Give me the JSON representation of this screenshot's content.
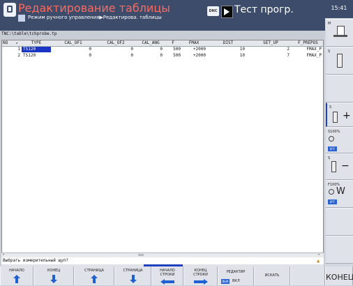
{
  "header": {
    "title": "Редактирование таблицы",
    "subtitle": "Режим ручного управления▶Редактирова. таблицы",
    "dnc_label": "DNC",
    "mode_label": "Тест прогр."
  },
  "clock": "15:41",
  "path": "TNC:\\table\\tchprobe.tp",
  "columns": [
    "NO",
    "TYPE",
    "CAL_OF1",
    "CAL_OF2",
    "CAL_ANG",
    "F",
    "FMAX",
    "DIST",
    "SET_UP",
    "F_PREPOS"
  ],
  "rows": [
    {
      "no": "1",
      "type": "TS120",
      "cal_of1": "0",
      "cal_of2": "0",
      "cal_ang": "0",
      "f": "500",
      "fmax": "+2000",
      "dist": "10",
      "set_up": "2",
      "f_prepos": "FMAX_P",
      "selected": true
    },
    {
      "no": "2",
      "type": "TS120",
      "cal_of1": "0",
      "cal_of2": "0",
      "cal_ang": "0",
      "f": "500",
      "fmax": "+2000",
      "dist": "10",
      "set_up": "7",
      "f_prepos": "FMAX_P",
      "selected": false
    }
  ],
  "prompt": "Выбрать измерительный щуп?",
  "softkeys": {
    "k1": "НАЧАЛО",
    "k2": "КОНЕЦ",
    "k3": "СТРАНИЦА",
    "k4": "СТРАНИЦА",
    "k5a": "НАЧАЛО",
    "k5b": "СТРОКИ",
    "k6a": "КОНЕЦ",
    "k6b": "СТРОКИ",
    "k7": "РЕДАКТИР",
    "k7_off": "ВЫК",
    "k7_on": "ВКЛ",
    "k8": "ИСКАТЬ",
    "k10": "КОНЕЦ"
  },
  "side": {
    "m": "M",
    "s": "S",
    "s100": "S100%",
    "f100": "F100%",
    "off": "OFF"
  },
  "colors": {
    "header_bg": "#3c4c6a",
    "title": "#ff6a5f",
    "selection": "#1a34c6",
    "accent": "#1e60d0"
  }
}
